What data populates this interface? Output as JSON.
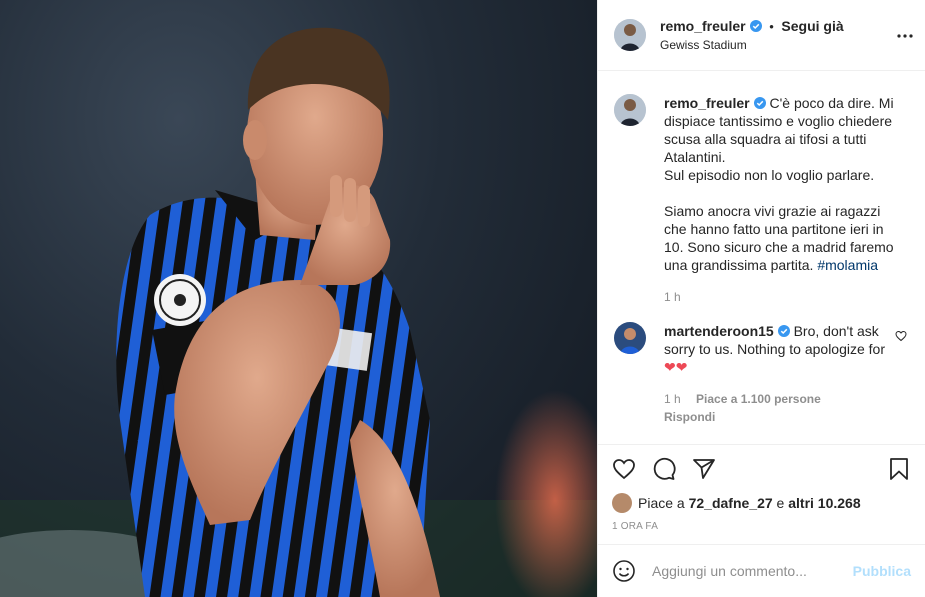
{
  "post": {
    "username": "remo_freuler",
    "follow_label": "Segui già",
    "location": "Gewiss Stadium",
    "separator": "•"
  },
  "caption": {
    "username": "remo_freuler",
    "text_1": "C'è poco da dire. Mi dispiace tantissimo e voglio chiedere scusa alla squadra ai tifosi a tutti Atalantini.\nSul episodio non lo voglio parlare.",
    "text_2": "Siamo anocra vivi grazie ai ragazzi che hanno fatto una partitone ieri in 10. Sono sicuro che a madrid faremo una grandissima partita.",
    "hashtag": "#molamia",
    "time": "1 h"
  },
  "comment": {
    "username": "martenderoon15",
    "text": "Bro, don't ask sorry to us. Nothing to apologize for",
    "emoji": "❤❤",
    "time": "1 h",
    "likes": "Piace a 1.100 persone",
    "reply": "Rispondi"
  },
  "likes": {
    "prefix": "Piace a",
    "user": "72_dafne_27",
    "middle": "e",
    "others": "altri 10.268"
  },
  "post_time": "1 ora fa",
  "composer": {
    "placeholder": "Aggiungi un commento...",
    "publish": "Pubblica"
  },
  "colors": {
    "verified": "#3897f0",
    "hashtag": "#00376b",
    "muted": "#8e8e8e",
    "publish_disabled": "#b2dffc",
    "heart": "#ed4956",
    "stripe_blue": "#1f5fd6",
    "stripe_black": "#111111"
  },
  "icons": [
    "verified-badge-icon",
    "more-options-icon",
    "heart-icon",
    "comment-icon",
    "share-icon",
    "bookmark-icon",
    "emoji-icon"
  ]
}
